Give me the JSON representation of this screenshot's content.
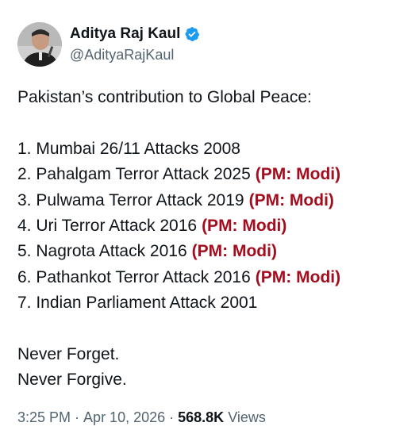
{
  "author": {
    "display_name": "Aditya Raj Kaul",
    "handle": "@AdityaRajKaul",
    "verified_icon": "verified-badge-icon",
    "verified_color": "#1d9bf0"
  },
  "tweet": {
    "intro": "Pakistan’s contribution to Global Peace:",
    "items": [
      {
        "text": "1. Mumbai 26/11 Attacks 2008",
        "tag": ""
      },
      {
        "text": "2. Pahalgam Terror Attack 2025",
        "tag": "(PM: Modi)"
      },
      {
        "text": "3. Pulwama Terror Attack 2019",
        "tag": "(PM: Modi)"
      },
      {
        "text": "4. Uri Terror Attack 2016",
        "tag": "(PM: Modi)"
      },
      {
        "text": "5. Nagrota Attack 2016",
        "tag": "(PM: Modi)"
      },
      {
        "text": "6. Pathankot Terror Attack 2016",
        "tag": "(PM: Modi)"
      },
      {
        "text": "7. Indian Parliament Attack 2001",
        "tag": ""
      }
    ],
    "closing_1": "Never Forget.",
    "closing_2": "Never Forgive.",
    "tag_color": "#a30d1e"
  },
  "meta": {
    "time": "3:25 PM",
    "separator": "·",
    "date": "Apr 10, 2026",
    "views_count": "568.8K",
    "views_label": "Views"
  }
}
